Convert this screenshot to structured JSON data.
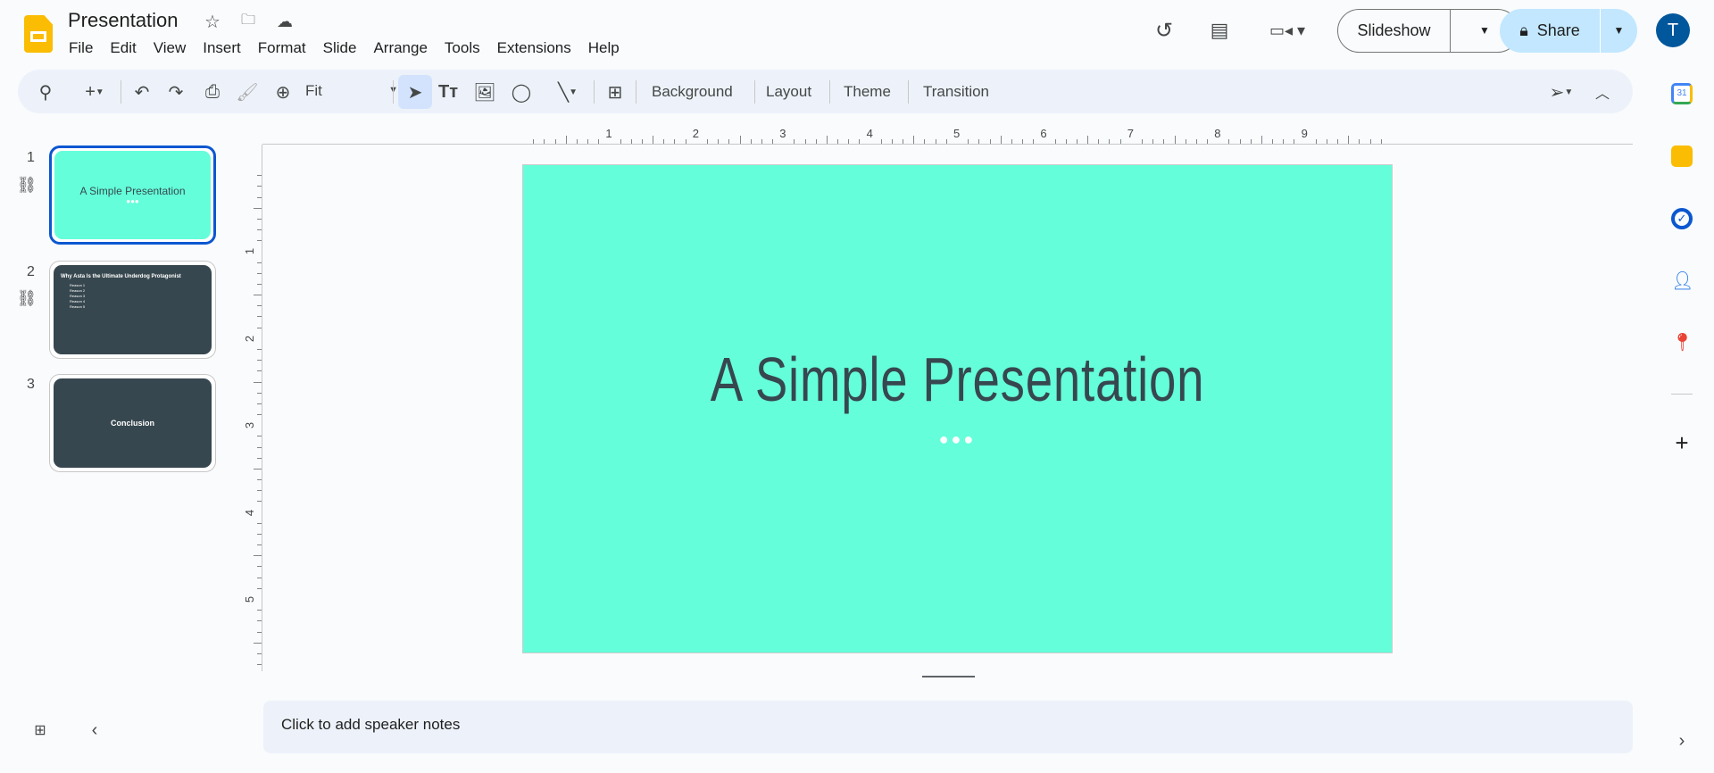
{
  "app": {
    "title": "Presentation",
    "menu": [
      "File",
      "Edit",
      "View",
      "Insert",
      "Format",
      "Slide",
      "Arrange",
      "Tools",
      "Extensions",
      "Help"
    ],
    "accent": "#0b57d0"
  },
  "header": {
    "slideshow_label": "Slideshow",
    "share_label": "Share",
    "avatar_letter": "T",
    "avatar_color": "#01579b",
    "share_color": "#c2e7ff"
  },
  "toolbar": {
    "zoom_value": "Fit",
    "background": "Background",
    "layout": "Layout",
    "theme": "Theme",
    "transition": "Transition"
  },
  "ruler": {
    "h": [
      "1",
      "2",
      "3",
      "4",
      "5",
      "6",
      "7",
      "8",
      "9"
    ],
    "v": [
      "1",
      "2",
      "3",
      "4",
      "5"
    ]
  },
  "slides": [
    {
      "number": "1",
      "title": "A Simple Presentation",
      "bg": "#64ffda",
      "selected": true
    },
    {
      "number": "2",
      "title": "Why Asta Is the Ultimate Underdog Protagonist",
      "bullets": [
        "Reason 1",
        "Reason 2",
        "Reason 3",
        "Reason 4",
        "Reason 5"
      ],
      "bg": "#37474f"
    },
    {
      "number": "3",
      "title": "Conclusion",
      "bg": "#37474f"
    }
  ],
  "canvas": {
    "title": "A Simple Presentation",
    "bg": "#64ffda",
    "text_color": "#37474f"
  },
  "notes": {
    "placeholder": "Click to add speaker notes"
  }
}
